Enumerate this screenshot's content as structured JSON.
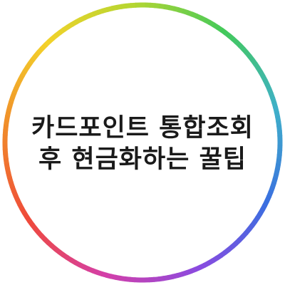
{
  "ring": {
    "colors": [
      "#f3d22a",
      "#b5d631",
      "#43c95a",
      "#3fb0c9",
      "#3a6fe0",
      "#8a4be0",
      "#d43fa8",
      "#ef4a3a",
      "#f08a2a",
      "#f3d22a"
    ]
  },
  "title": {
    "line1": "카드포인트 통합조회",
    "line2": "후 현금화하는 꿀팁"
  }
}
